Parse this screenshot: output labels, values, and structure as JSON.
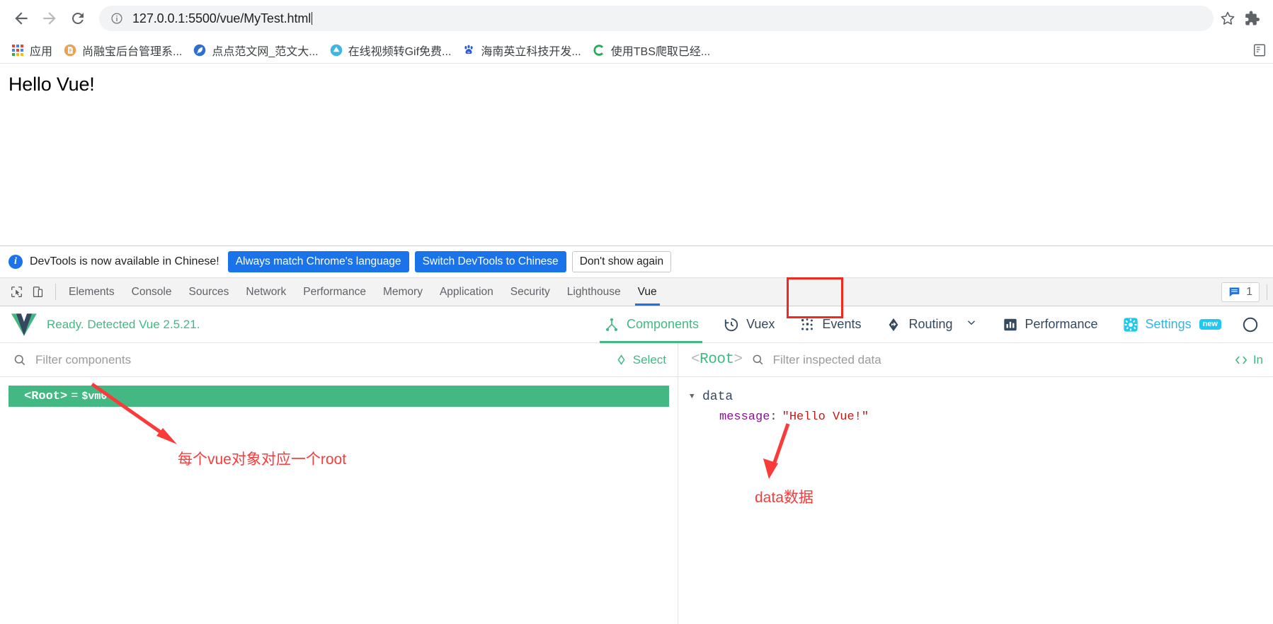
{
  "browser": {
    "nav": {
      "back_label": "Back",
      "forward_label": "Forward",
      "reload_label": "Reload"
    },
    "omnibox": {
      "url": "127.0.0.1:5500/vue/MyTest.html",
      "info_icon": "info-circle-icon",
      "star_icon": "star-icon"
    },
    "extensions_icon": "puzzle-piece-icon",
    "bookmarks": [
      {
        "icon": "apps-grid-icon",
        "label": "应用"
      },
      {
        "icon": "document-icon",
        "label": "尚融宝后台管理系..."
      },
      {
        "icon": "feather-icon",
        "label": "点点范文网_范文大..."
      },
      {
        "icon": "cloud-icon",
        "label": "在线视频转Gif免费..."
      },
      {
        "icon": "baidu-paw-icon",
        "label": "海南英立科技开发..."
      },
      {
        "icon": "c-circle-icon",
        "label": "使用TBS爬取已经..."
      }
    ],
    "bookmarks_overflow_icon": "reading-list-icon"
  },
  "page": {
    "heading": "Hello Vue!"
  },
  "devtools": {
    "banner": {
      "info_icon": "info-icon",
      "message": "DevTools is now available in Chinese!",
      "primary_btn": "Always match Chrome's language",
      "secondary_btn": "Switch DevTools to Chinese",
      "dismiss_btn": "Don't show again"
    },
    "tool_icons": [
      {
        "name": "inspect-element-icon"
      },
      {
        "name": "device-toolbar-icon"
      }
    ],
    "tabs": [
      {
        "label": "Elements",
        "active": false
      },
      {
        "label": "Console",
        "active": false
      },
      {
        "label": "Sources",
        "active": false
      },
      {
        "label": "Network",
        "active": false
      },
      {
        "label": "Performance",
        "active": false
      },
      {
        "label": "Memory",
        "active": false
      },
      {
        "label": "Application",
        "active": false
      },
      {
        "label": "Security",
        "active": false
      },
      {
        "label": "Lighthouse",
        "active": false
      },
      {
        "label": "Vue",
        "active": true
      }
    ],
    "message_count": "1",
    "message_icon": "message-bubble-icon",
    "highlight_color": "#f0281e"
  },
  "vue": {
    "logo_icon": "vue-logo-icon",
    "status": "Ready. Detected Vue 2.5.21.",
    "nav": [
      {
        "label": "Components",
        "icon": "components-tree-icon",
        "active": true,
        "chevron": false,
        "badge": ""
      },
      {
        "label": "Vuex",
        "icon": "vuex-clock-icon",
        "active": false,
        "chevron": false,
        "badge": ""
      },
      {
        "label": "Events",
        "icon": "events-dots-icon",
        "active": false,
        "chevron": false,
        "badge": ""
      },
      {
        "label": "Routing",
        "icon": "routing-arrow-icon",
        "active": false,
        "chevron": true,
        "badge": ""
      },
      {
        "label": "Performance",
        "icon": "performance-bar-icon",
        "active": false,
        "chevron": false,
        "badge": ""
      },
      {
        "label": "Settings",
        "icon": "settings-gear-icon",
        "active": false,
        "chevron": false,
        "badge": "new"
      },
      {
        "label": "",
        "icon": "refresh-circle-icon",
        "active": false,
        "chevron": false,
        "badge": ""
      }
    ],
    "components_panel": {
      "search_icon": "search-icon",
      "filter_placeholder": "Filter components",
      "select_icon": "target-select-icon",
      "select_label": "Select",
      "tree": [
        {
          "tag": "<Root>",
          "eq": "=",
          "vm": "$vm0",
          "selected": true
        }
      ]
    },
    "inspector_panel": {
      "root_open": "<",
      "root_name": "Root",
      "root_close": ">",
      "search_icon": "search-icon",
      "filter_placeholder": "Filter inspected data",
      "inspect_dom_icon": "code-brackets-icon",
      "inspect_dom_label": "In",
      "groups": [
        {
          "caret": "▼",
          "name": "data",
          "entries": [
            {
              "key": "message",
              "colon": ":",
              "value": "\"Hello Vue!\""
            }
          ]
        }
      ]
    }
  },
  "annotations": [
    {
      "name": "root-annotation",
      "text": "每个vue对象对应一个root"
    },
    {
      "name": "data-annotation",
      "text": "data数据"
    }
  ],
  "colors": {
    "vue_green": "#42b983",
    "chrome_blue": "#1a73e8",
    "annotation_red": "#fb3a3a",
    "settings_blue": "#2fb6e9"
  }
}
